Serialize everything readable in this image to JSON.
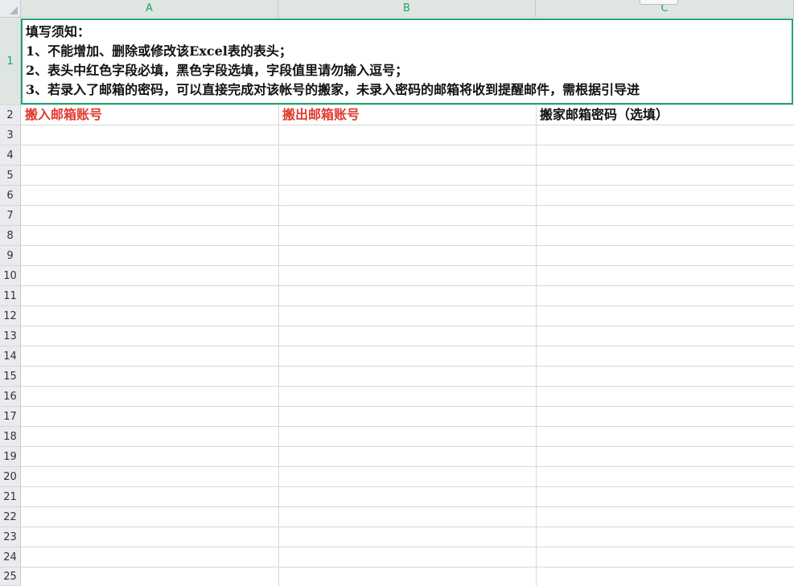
{
  "columns": [
    "A",
    "B",
    "C"
  ],
  "rows": [
    "1",
    "2",
    "3",
    "4",
    "5",
    "6",
    "7",
    "8",
    "9",
    "10",
    "11",
    "12",
    "13",
    "14",
    "15",
    "16",
    "17",
    "18",
    "19",
    "20",
    "21",
    "22",
    "23",
    "24",
    "25"
  ],
  "notice": {
    "title": "填写须知：",
    "line1": "1、不能增加、删除或修改该Excel表的表头；",
    "line2": "2、表头中红色字段必填，黑色字段选填，字段值里请勿输入逗号；",
    "line3": "3、若录入了邮箱的密码，可以直接完成对该帐号的搬家，未录入密码的邮箱将收到提醒邮件，需根据引导进"
  },
  "headers": {
    "a": "搬入邮箱账号",
    "b": "搬出邮箱账号",
    "c": "搬家邮箱密码（选填）"
  },
  "colors": {
    "required": "#e03a2f",
    "optional": "#111111",
    "selection": "#1fa56e"
  }
}
